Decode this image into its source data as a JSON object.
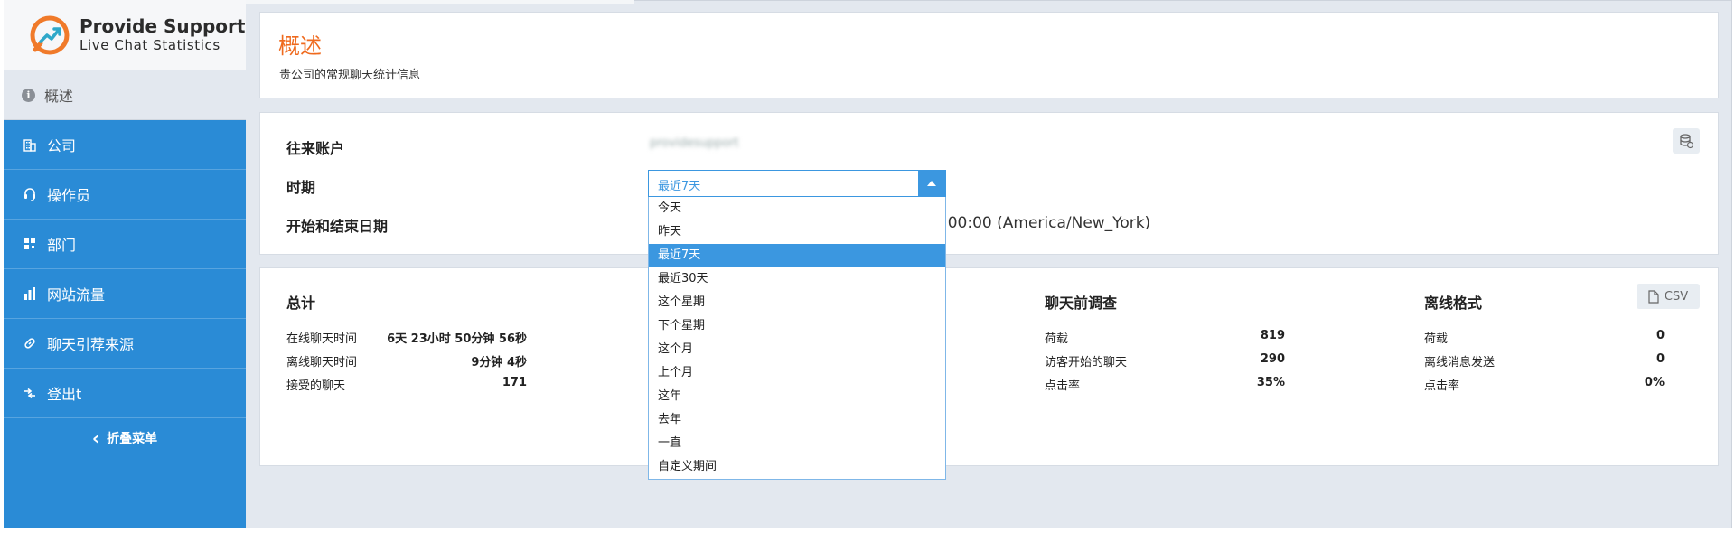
{
  "brand": {
    "title": "Provide Support",
    "subtitle": "Live Chat Statistics"
  },
  "sidebar": {
    "current": {
      "label": "概述",
      "icon": "info-icon"
    },
    "items": [
      {
        "label": "公司",
        "icon": "building-icon"
      },
      {
        "label": "操作员",
        "icon": "headset-icon"
      },
      {
        "label": "部门",
        "icon": "departments-icon"
      },
      {
        "label": "网站流量",
        "icon": "bar-chart-icon"
      },
      {
        "label": "聊天引荐来源",
        "icon": "link-icon"
      },
      {
        "label": "登出t",
        "icon": "logout-icon"
      }
    ],
    "collapse_label": "折叠菜单"
  },
  "overview": {
    "title": "概述",
    "subtitle": "贵公司的常规聊天统计信息"
  },
  "filters": {
    "account_label": "往来账户",
    "account_value": "providesupport",
    "period_label": "时期",
    "period_selected": "最近7天",
    "date_range_label": "开始和结束日期",
    "date_range_value": ":00:00 (America/New_York)",
    "period_options": [
      "今天",
      "昨天",
      "最近7天",
      "最近30天",
      "这个星期",
      "下个星期",
      "这个月",
      "上个月",
      "这年",
      "去年",
      "一直",
      "自定义期间"
    ],
    "active_option_index": 2
  },
  "stats": {
    "csv_label": "CSV",
    "total": {
      "title": "总计",
      "rows": [
        {
          "label": "在线聊天时间",
          "value": "6天 23小时 50分钟 56秒"
        },
        {
          "label": "离线聊天时间",
          "value": "9分钟 4秒"
        },
        {
          "label": "接受的聊天",
          "value": "171"
        }
      ]
    },
    "pre_chat": {
      "title": "聊天前调查",
      "rows": [
        {
          "label": "荷载",
          "value": "819"
        },
        {
          "label": "访客开始的聊天",
          "value": "290"
        },
        {
          "label": "点击率",
          "value": "35%"
        }
      ]
    },
    "offline": {
      "title": "离线格式",
      "rows": [
        {
          "label": "荷载",
          "value": "0"
        },
        {
          "label": "离线消息发送",
          "value": "0"
        },
        {
          "label": "点击率",
          "value": "0%"
        }
      ]
    }
  },
  "colors": {
    "sidebar": "#2a8bd6",
    "accent": "#3b97e0",
    "title_orange": "#ef6a1e",
    "background": "#e3e8ef"
  }
}
